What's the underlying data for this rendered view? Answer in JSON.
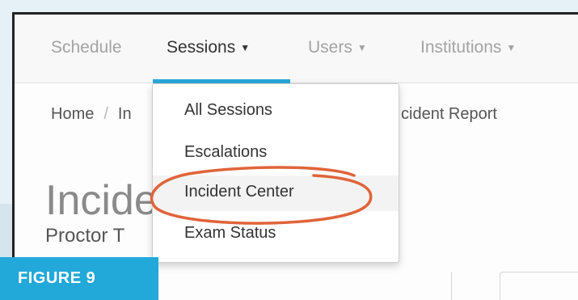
{
  "navbar": {
    "items": [
      {
        "label": "Schedule",
        "caret": ""
      },
      {
        "label": "Sessions",
        "caret": "▼"
      },
      {
        "label": "Users",
        "caret": "▼"
      },
      {
        "label": "Institutions",
        "caret": "▼"
      }
    ],
    "active_index": 1
  },
  "breadcrumb": {
    "home": "Home",
    "separator": "/",
    "partial": "In",
    "current_tail": "cident Report"
  },
  "page": {
    "title": "Incide",
    "subtitle": "Proctor T"
  },
  "dropdown": {
    "items": [
      "All Sessions",
      "Escalations",
      "Incident Center",
      "Exam Status"
    ],
    "highlighted_index": 2
  },
  "figure_label": "FIGURE 9",
  "colors": {
    "accent": "#29a9d8",
    "annotation_circle": "#e0643a",
    "figure_label_bg": "#22a8d9"
  }
}
